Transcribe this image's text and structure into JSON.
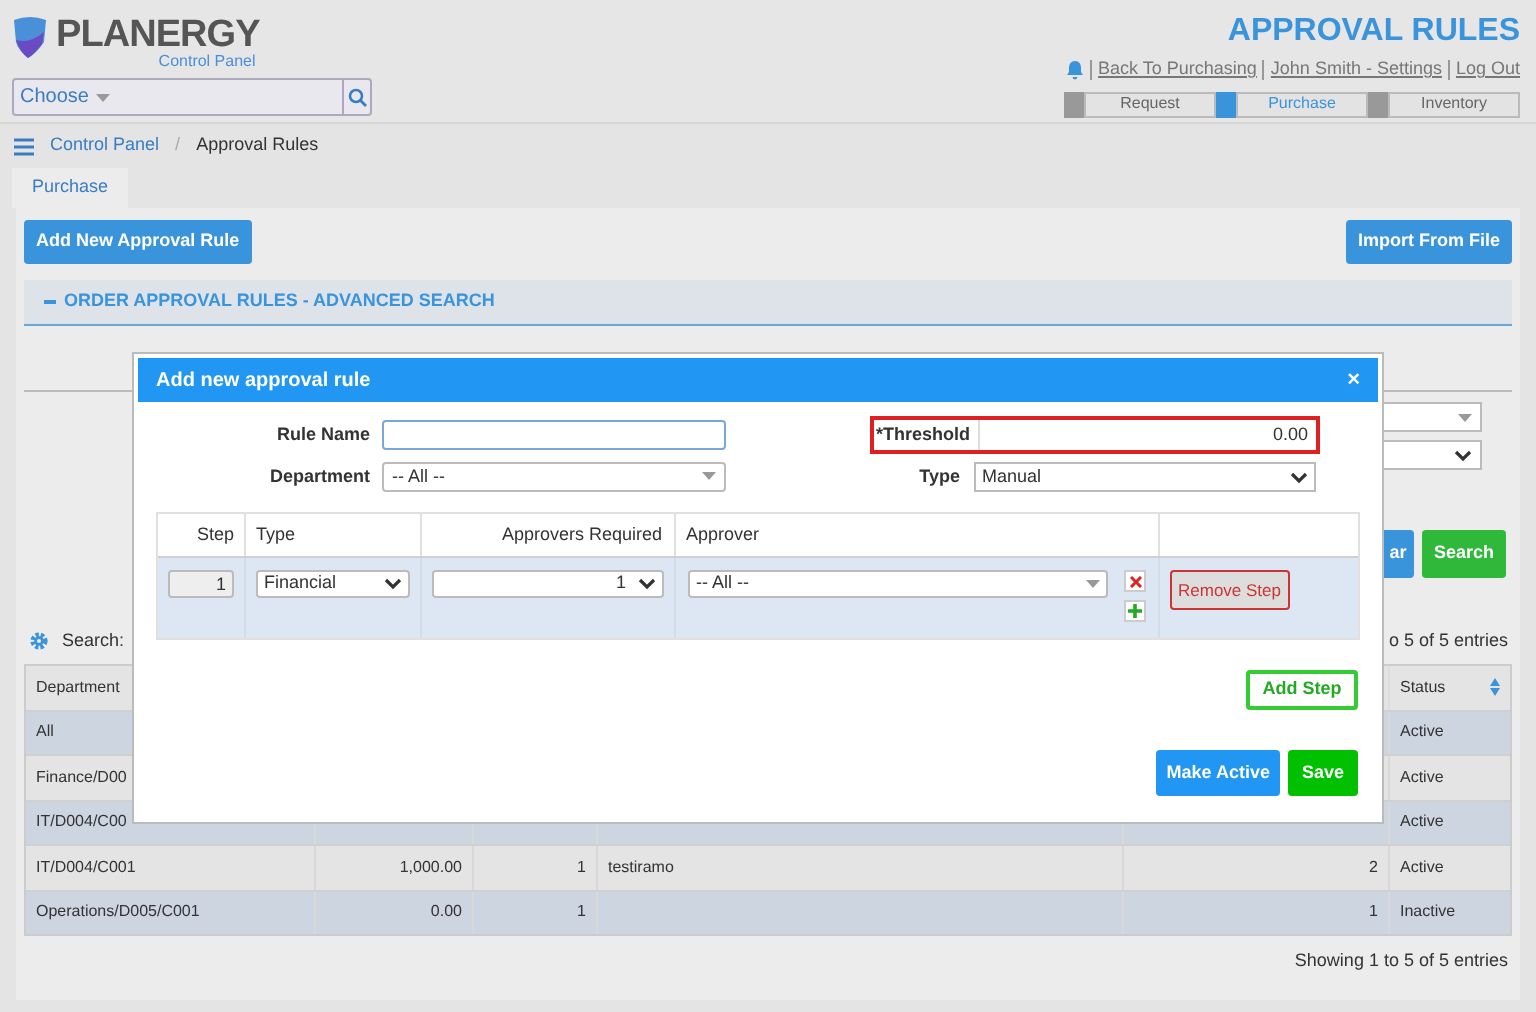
{
  "header": {
    "logo": "PLANERGY",
    "logo_subtitle": "Control Panel",
    "choose": "Choose",
    "page_title": "APPROVAL RULES",
    "links": [
      "Back To Purchasing",
      "John Smith - Settings",
      "Log Out"
    ],
    "modules": [
      {
        "label": "Request",
        "selected": false
      },
      {
        "label": "Purchase",
        "selected": true
      },
      {
        "label": "Inventory",
        "selected": false
      }
    ]
  },
  "breadcrumb": {
    "items": [
      "Control Panel",
      "Approval Rules"
    ],
    "separator": "/"
  },
  "tabs": [
    {
      "label": "Purchase",
      "selected": true
    }
  ],
  "toolbar": {
    "add_button": "Add New Approval Rule",
    "import_button": "Import From File"
  },
  "advanced_search": {
    "title": "ORDER APPROVAL RULES - ADVANCED SEARCH",
    "expanded": true,
    "clear_button": "ar",
    "search_button": "Search"
  },
  "list": {
    "search_label": "Search:",
    "info_top": "o 5 of 5 entries",
    "info_bottom": "Showing 1 to 5 of 5 entries",
    "columns": [
      "Department",
      "Status"
    ],
    "rows": [
      {
        "department": "All",
        "status": "Active"
      },
      {
        "department": "Finance/D00",
        "status": "Active"
      },
      {
        "department": "IT/D004/C00",
        "status": "Active"
      },
      {
        "department": "IT/D004/C001",
        "amount": "1,000.00",
        "approvers": "1",
        "name": "testiramo",
        "steps": "2",
        "status": "Active"
      },
      {
        "department": "Operations/D005/C001",
        "amount": "0.00",
        "approvers": "1",
        "steps": "1",
        "status": "Inactive"
      }
    ]
  },
  "dialog": {
    "title": "Add new approval rule",
    "close": "×",
    "rule_name": {
      "label": "Rule Name"
    },
    "department": {
      "label": "Department",
      "value": "-- All --"
    },
    "threshold": {
      "label": "*Threshold",
      "value": "0.00",
      "error": true
    },
    "type": {
      "label": "Type",
      "value": "Manual"
    },
    "steps": {
      "columns": [
        "Step",
        "Type",
        "Approvers Required",
        "Approver"
      ],
      "rows": [
        {
          "step": "1",
          "type": "Financial",
          "approvers_required": "1",
          "approver": "-- All --",
          "remove_button": "Remove Step"
        }
      ]
    },
    "add_step_button": "Add Step",
    "make_active_button": "Make Active",
    "save_button": "Save"
  }
}
